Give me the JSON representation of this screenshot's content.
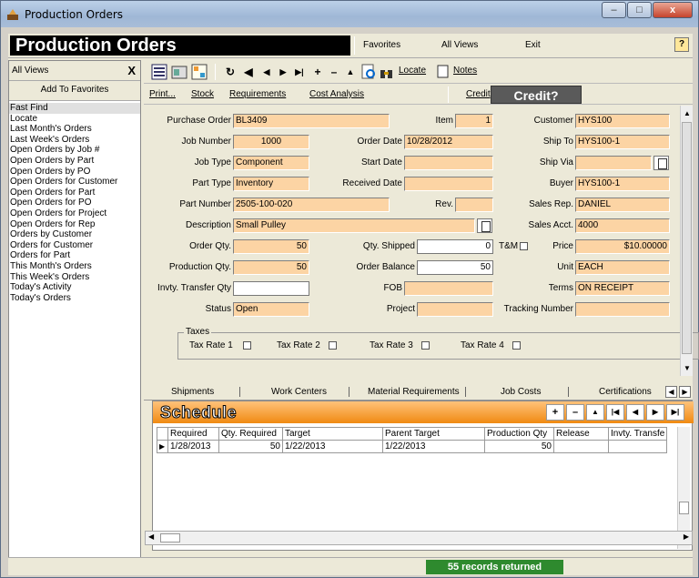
{
  "window": {
    "title": "Production Orders"
  },
  "header": {
    "title": "Production Orders",
    "favorites": "Favorites",
    "all_views": "All Views",
    "exit": "Exit",
    "help": "?"
  },
  "sidebar": {
    "all_views_label": "All Views",
    "close": "X",
    "add_favorites": "Add To Favorites",
    "items": [
      "Fast Find",
      "Locate",
      "Last Month's Orders",
      "Last Week's Orders",
      "Open Orders by Job #",
      "Open Orders by Part",
      "Open Orders by PO",
      "Open Orders for Customer",
      "Open Orders for Part",
      "Open Orders for PO",
      "Open Orders for Project",
      "Open Orders for Rep",
      "Orders by Customer",
      "Orders for Customer",
      "Orders for Part",
      "This Month's Orders",
      "This Week's Orders",
      "Today's Activity",
      "Today's Orders"
    ]
  },
  "toolbar": {
    "locate": "Locate",
    "notes": "Notes"
  },
  "actions": {
    "print": "Print...",
    "stock": "Stock",
    "requirements": "Requirements",
    "cost_analysis": "Cost Analysis",
    "credit": "Credit",
    "credit_banner": "Credit?"
  },
  "form": {
    "purchase_order_label": "Purchase Order",
    "purchase_order": "BL3409",
    "item_label": "Item",
    "item": "1",
    "customer_label": "Customer",
    "customer": "HYS100",
    "job_number_label": "Job Number",
    "job_number": "1000",
    "order_date_label": "Order Date",
    "order_date": "10/28/2012",
    "ship_to_label": "Ship To",
    "ship_to": "HYS100-1",
    "job_type_label": "Job Type",
    "job_type": "Component",
    "start_date_label": "Start Date",
    "start_date": "",
    "ship_via_label": "Ship Via",
    "ship_via": "",
    "part_type_label": "Part Type",
    "part_type": "Inventory",
    "received_date_label": "Received Date",
    "received_date": "",
    "buyer_label": "Buyer",
    "buyer": "HYS100-1",
    "part_number_label": "Part Number",
    "part_number": "2505-100-020",
    "rev_label": "Rev.",
    "rev": "",
    "sales_rep_label": "Sales Rep.",
    "sales_rep": "DANIEL",
    "description_label": "Description",
    "description": "Small Pulley",
    "sales_acct_label": "Sales Acct.",
    "sales_acct": "4000",
    "order_qty_label": "Order Qty.",
    "order_qty": "50",
    "qty_shipped_label": "Qty. Shipped",
    "qty_shipped": "0",
    "tm_label": "T&M",
    "price_label": "Price",
    "price": "$10.00000",
    "production_qty_label": "Production Qty.",
    "production_qty": "50",
    "order_balance_label": "Order Balance",
    "order_balance": "50",
    "unit_label": "Unit",
    "unit": "EACH",
    "invty_transfer_label": "Invty. Transfer Qty",
    "invty_transfer": "",
    "fob_label": "FOB",
    "fob": "",
    "terms_label": "Terms",
    "terms": "ON RECEIPT",
    "status_label": "Status",
    "status": "Open",
    "project_label": "Project",
    "project": "",
    "tracking_label": "Tracking Number",
    "tracking": "",
    "taxes_label": "Taxes",
    "tax1": "Tax Rate 1",
    "tax2": "Tax Rate 2",
    "tax3": "Tax Rate 3",
    "tax4": "Tax Rate 4"
  },
  "tabs": [
    "Shipments",
    "Work Centers",
    "Material Requirements",
    "Job Costs",
    "Certifications"
  ],
  "schedule": {
    "title": "Schedule",
    "columns": [
      "Required",
      "Qty. Required",
      "Target",
      "Parent Target",
      "Production Qty",
      "Release",
      "Invty. Transfe"
    ],
    "rows": [
      [
        "1/28/2013",
        "50",
        "1/22/2013",
        "1/22/2013",
        "50",
        "",
        ""
      ]
    ]
  },
  "status": {
    "records": "55 records returned"
  }
}
